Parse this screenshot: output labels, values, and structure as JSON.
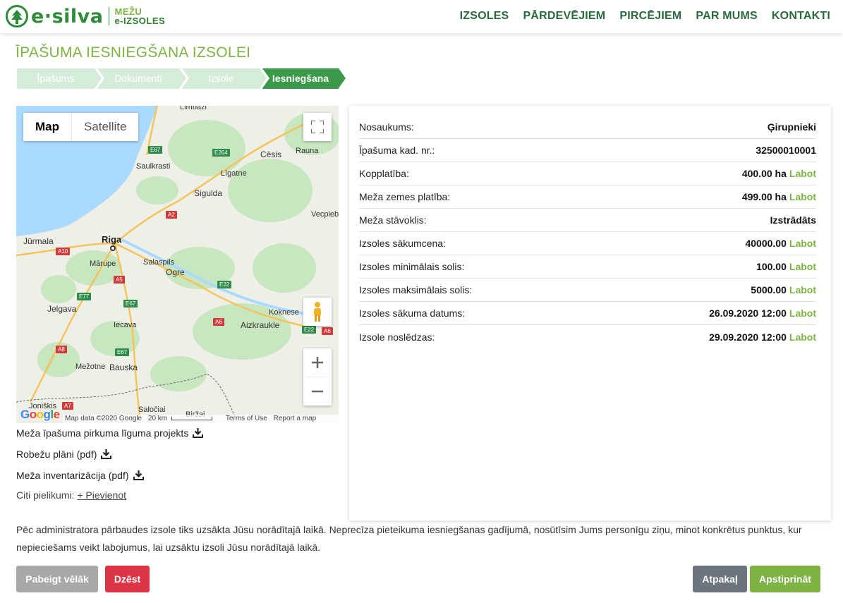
{
  "header": {
    "logo_main": "e·silva",
    "logo_sub_1": "MEŽU",
    "logo_sub_2": "e-IZSOLES",
    "nav": [
      "IZSOLES",
      "PĀRDEVĒJIEM",
      "PIRCĒJIEM",
      "PAR MUMS",
      "KONTAKTI"
    ]
  },
  "page_title": "ĪPAŠUMA IESNIEGŠANA IZSOLEI",
  "steps": [
    "Īpašums",
    "Dokumenti",
    "Izsole",
    "Iesniegšana"
  ],
  "active_step": "Iesniegšana",
  "map": {
    "type_buttons": [
      "Map",
      "Satellite"
    ],
    "active_type": "Map",
    "google": "Google",
    "attribution": "Map data ©2020 Google",
    "scale": "20 km",
    "terms": "Terms of Use",
    "report": "Report a map error",
    "labels": {
      "limbazi": "Limbaži",
      "saulkrasti": "Saulkrasti",
      "cesis": "Cēsis",
      "rauna": "Rauna",
      "ligatne": "Līgatne",
      "sigulda": "Sigulda",
      "vecpiebalga": "Vecpiebalga",
      "jurmala": "Jūrmala",
      "riga": "Riga",
      "marupe": "Mārupe",
      "salaspils": "Salaspils",
      "ogre": "Ogre",
      "jelgava": "Jelgava",
      "iecava": "Iecava",
      "koknese": "Koknese",
      "aizkraukle": "Aizkraukle",
      "mezotne": "Mežotne",
      "bauska": "Bauska",
      "joniskis": "Joniškis",
      "saločiai": "Saločiai",
      "birzai": "Biržai"
    },
    "shields": [
      "E67",
      "E264",
      "A2",
      "A10",
      "A5",
      "E22",
      "E77",
      "E67",
      "A6",
      "E22",
      "A6",
      "A8",
      "E67",
      "A7"
    ]
  },
  "documents": [
    "Meža īpašuma pirkuma līguma projekts",
    "Robežu plāni (pdf)",
    "Meža inventarizācija (pdf)"
  ],
  "other_attachments_label": "Citi pielikumi:",
  "other_attachments_link": "+ Pievienot",
  "details": [
    {
      "label": "Nosaukums:",
      "value": "Ģirupnieki",
      "edit": ""
    },
    {
      "label": "Īpašuma kad. nr.:",
      "value": "32500010001",
      "edit": ""
    },
    {
      "label": "Kopplatība:",
      "value": "400.00 ha",
      "edit": "Labot"
    },
    {
      "label": "Meža zemes platība:",
      "value": "499.00 ha",
      "edit": "Labot"
    },
    {
      "label": "Meža stāvoklis:",
      "value": "Izstrādāts",
      "edit": ""
    },
    {
      "label": "Izsoles sākumcena:",
      "value": "40000.00",
      "edit": "Labot"
    },
    {
      "label": "Izsoles minimālais solis:",
      "value": "100.00",
      "edit": "Labot"
    },
    {
      "label": "Izsoles maksimālais solis:",
      "value": "5000.00",
      "edit": "Labot"
    },
    {
      "label": "Izsoles sākuma datums:",
      "value": "26.09.2020 12:00",
      "edit": "Labot"
    },
    {
      "label": "Izsole noslēdzas:",
      "value": "29.09.2020 12:00",
      "edit": "Labot"
    }
  ],
  "notice": "Pēc administratora pārbaudes izsole tiks uzsākta Jūsu norādītajā laikā. Neprecīza pieteikuma iesniegšanas gadījumā, nosūtīsim Jums personīgu ziņu, minot konkrētus punktus, kur nepieciešams veikt labojumus, lai uzsāktu izsoli Jūsu norādītajā laikā.",
  "buttons": {
    "later": "Pabeigt vēlāk",
    "delete": "Dzēst",
    "back": "Atpakaļ",
    "confirm": "Apstiprināt"
  },
  "colors": {
    "brand_green": "#2e8b3a",
    "accent_green": "#7cb342",
    "step_active": "#3a9a4a",
    "step_inactive": "#d4ecd8",
    "danger": "#dc3545",
    "secondary": "#6c757d"
  }
}
